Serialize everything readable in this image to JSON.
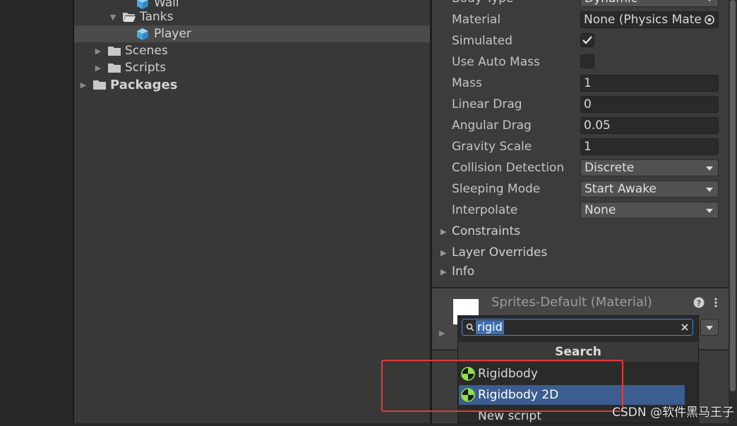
{
  "project_tree": {
    "items": [
      {
        "label": "Wall",
        "kind": "prefab",
        "depth": 3
      },
      {
        "label": "Tanks",
        "kind": "folder-open",
        "depth": 2
      },
      {
        "label": "Player",
        "kind": "prefab",
        "depth": 3,
        "selected": true
      },
      {
        "label": "Scenes",
        "kind": "folder",
        "depth": 1
      },
      {
        "label": "Scripts",
        "kind": "folder",
        "depth": 1
      },
      {
        "label": "Packages",
        "kind": "folder",
        "depth": 0
      }
    ]
  },
  "inspector": {
    "body_type_label": "Body Type",
    "body_type_value": "Dynamic",
    "properties": {
      "material": {
        "label": "Material",
        "value": "None (Physics Mate"
      },
      "simulated": {
        "label": "Simulated",
        "checked": true
      },
      "use_auto_mass": {
        "label": "Use Auto Mass",
        "checked": false
      },
      "mass": {
        "label": "Mass",
        "value": "1"
      },
      "linear_drag": {
        "label": "Linear Drag",
        "value": "0"
      },
      "angular_drag": {
        "label": "Angular Drag",
        "value": "0.05"
      },
      "gravity_scale": {
        "label": "Gravity Scale",
        "value": "1"
      },
      "collision_detection": {
        "label": "Collision Detection",
        "value": "Discrete"
      },
      "sleeping_mode": {
        "label": "Sleeping Mode",
        "value": "Start Awake"
      },
      "interpolate": {
        "label": "Interpolate",
        "value": "None"
      }
    },
    "sections": {
      "constraints": "Constraints",
      "layer_overrides": "Layer Overrides",
      "info": "Info"
    },
    "material_asset": "Sprites-Default (Material)"
  },
  "add_component_popup": {
    "search_value": "rigid",
    "header": "Search",
    "items": [
      "Rigidbody",
      "Rigidbody 2D",
      "New script"
    ],
    "highlighted_index": 1
  },
  "watermark": "CSDN @软件黑马王子",
  "colors": {
    "selection": "#3b5d8f",
    "search_focus": "#3f8ad9",
    "annotation_red": "#e03b3b"
  }
}
